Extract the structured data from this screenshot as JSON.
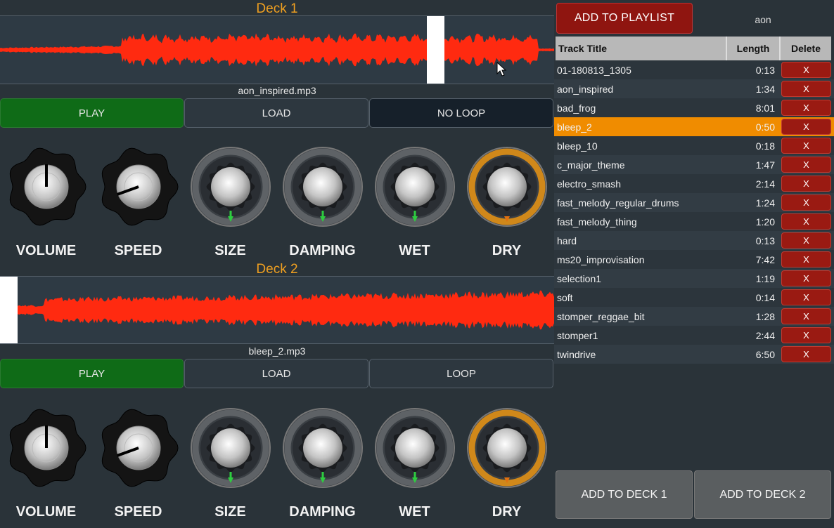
{
  "decks": [
    {
      "title": "Deck 1",
      "filename": "aon_inspired.mp3",
      "buttons": {
        "play": "PLAY",
        "load": "LOAD",
        "loop": "NO LOOP"
      },
      "playhead_fraction": 0.785,
      "knobs": [
        {
          "label": "VOLUME",
          "style": "black"
        },
        {
          "label": "SPEED",
          "style": "black"
        },
        {
          "label": "SIZE",
          "style": "gray"
        },
        {
          "label": "DAMPING",
          "style": "gray"
        },
        {
          "label": "WET",
          "style": "gray"
        },
        {
          "label": "DRY",
          "style": "orange"
        }
      ]
    },
    {
      "title": "Deck 2",
      "filename": "bleep_2.mp3",
      "buttons": {
        "play": "PLAY",
        "load": "LOAD",
        "loop": "LOOP"
      },
      "playhead_fraction": 0.015,
      "knobs": [
        {
          "label": "VOLUME",
          "style": "black"
        },
        {
          "label": "SPEED",
          "style": "black"
        },
        {
          "label": "SIZE",
          "style": "gray"
        },
        {
          "label": "DAMPING",
          "style": "gray"
        },
        {
          "label": "WET",
          "style": "gray"
        },
        {
          "label": "DRY",
          "style": "orange"
        }
      ]
    }
  ],
  "playlist": {
    "add_button": "ADD TO PLAYLIST",
    "search_value": "aon",
    "columns": [
      "Track Title",
      "Length",
      "Delete"
    ],
    "selected_index": 3,
    "tracks": [
      {
        "title": "01-180813_1305",
        "length": "0:13",
        "delete": "X"
      },
      {
        "title": "aon_inspired",
        "length": "1:34",
        "delete": "X"
      },
      {
        "title": "bad_frog",
        "length": "8:01",
        "delete": "X"
      },
      {
        "title": "bleep_2",
        "length": "0:50",
        "delete": "X"
      },
      {
        "title": "bleep_10",
        "length": "0:18",
        "delete": "X"
      },
      {
        "title": "c_major_theme",
        "length": "1:47",
        "delete": "X"
      },
      {
        "title": "electro_smash",
        "length": "2:14",
        "delete": "X"
      },
      {
        "title": "fast_melody_regular_drums",
        "length": "1:24",
        "delete": "X"
      },
      {
        "title": "fast_melody_thing",
        "length": "1:20",
        "delete": "X"
      },
      {
        "title": "hard",
        "length": "0:13",
        "delete": "X"
      },
      {
        "title": "ms20_improvisation",
        "length": "7:42",
        "delete": "X"
      },
      {
        "title": "selection1",
        "length": "1:19",
        "delete": "X"
      },
      {
        "title": "soft",
        "length": "0:14",
        "delete": "X"
      },
      {
        "title": "stomper_reggae_bit",
        "length": "1:28",
        "delete": "X"
      },
      {
        "title": "stomper1",
        "length": "2:44",
        "delete": "X"
      },
      {
        "title": "twindrive",
        "length": "6:50",
        "delete": "X"
      }
    ],
    "deck_buttons": [
      "ADD TO DECK 1",
      "ADD TO DECK 2"
    ]
  },
  "colors": {
    "waveform": "#ff2a10",
    "deck_title": "#f0a020",
    "selected_row": "#f08c00",
    "play_button": "#0f6b17",
    "delete_button": "#9a1a12"
  }
}
